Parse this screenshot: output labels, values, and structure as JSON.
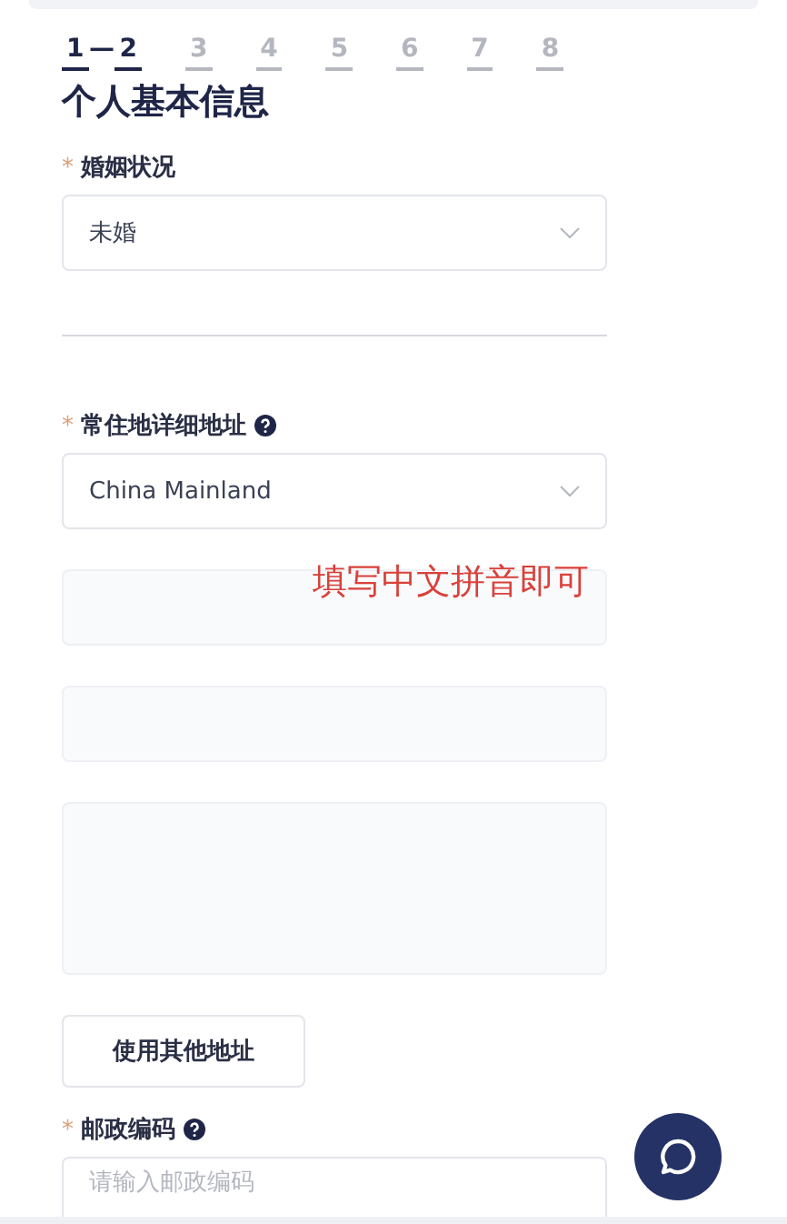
{
  "stepper": {
    "connector": "—",
    "steps": [
      {
        "label": "1",
        "active": true
      },
      {
        "label": "2",
        "active": true
      },
      {
        "label": "3",
        "active": false
      },
      {
        "label": "4",
        "active": false
      },
      {
        "label": "5",
        "active": false
      },
      {
        "label": "6",
        "active": false
      },
      {
        "label": "7",
        "active": false
      },
      {
        "label": "8",
        "active": false
      }
    ]
  },
  "title": "个人基本信息",
  "fields": [
    {
      "kind": "select",
      "required_mark": "*",
      "label": "婚姻状况",
      "help": false,
      "value": "未婚"
    },
    {
      "kind": "divider"
    },
    {
      "kind": "select",
      "required_mark": "*",
      "label": "常住地详细地址",
      "help": true,
      "value": "China Mainland"
    },
    {
      "kind": "input",
      "annotation": "填写中文拼音即可"
    },
    {
      "kind": "input"
    },
    {
      "kind": "textarea"
    },
    {
      "kind": "button",
      "text": "使用其他地址"
    },
    {
      "kind": "input",
      "required_mark": "*",
      "label": "邮政编码",
      "help": true,
      "placeholder": "请输入邮政编码"
    }
  ]
}
